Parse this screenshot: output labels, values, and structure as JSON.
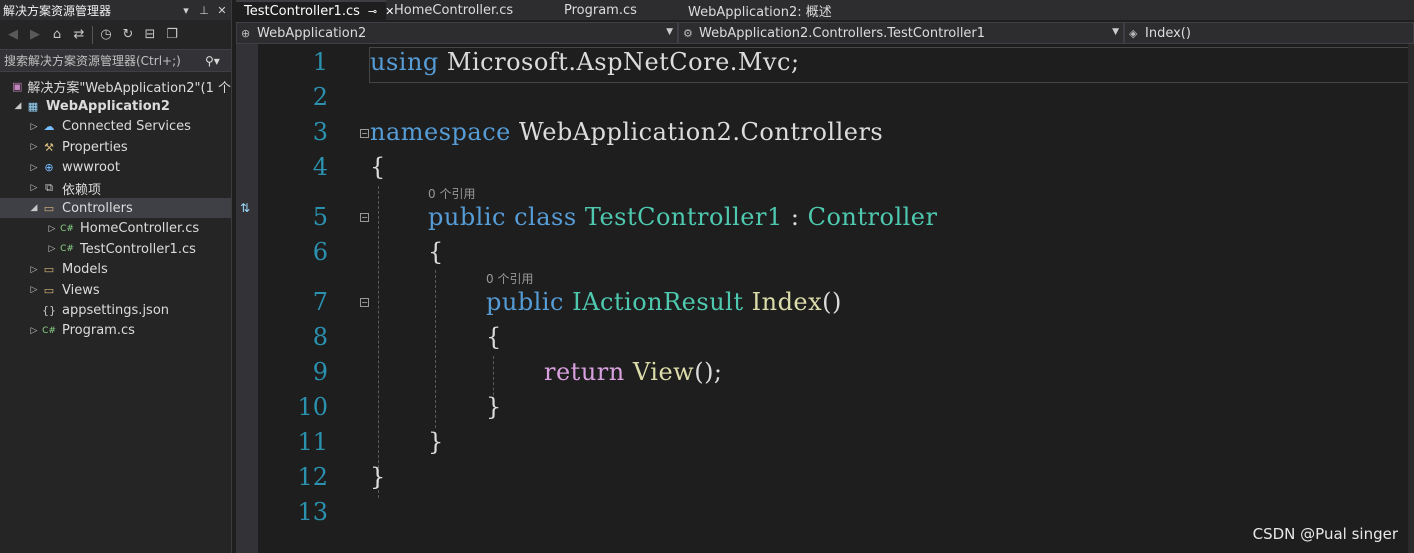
{
  "solution_explorer": {
    "title": "解决方案资源管理器",
    "search_placeholder": "搜索解决方案资源管理器(Ctrl+;)",
    "items": [
      {
        "label": "解决方案\"WebApplication2\"(1 个",
        "name": "tree-item-solution",
        "icon": "solution-icon"
      },
      {
        "label": "WebApplication2",
        "name": "tree-item-project",
        "icon": "project-icon"
      },
      {
        "label": "Connected Services",
        "name": "tree-item-connected-services",
        "icon": "connected-services-icon"
      },
      {
        "label": "Properties",
        "name": "tree-item-properties",
        "icon": "wrench-icon"
      },
      {
        "label": "wwwroot",
        "name": "tree-item-wwwroot",
        "icon": "globe-icon"
      },
      {
        "label": "依赖项",
        "name": "tree-item-dependencies",
        "icon": "dependencies-icon"
      },
      {
        "label": "Controllers",
        "name": "tree-item-controllers",
        "icon": "folder-open-icon"
      },
      {
        "label": "HomeController.cs",
        "name": "tree-item-homecontroller",
        "icon": "csharp-file-icon"
      },
      {
        "label": "TestController1.cs",
        "name": "tree-item-testcontroller1",
        "icon": "csharp-file-icon"
      },
      {
        "label": "Models",
        "name": "tree-item-models",
        "icon": "folder-icon"
      },
      {
        "label": "Views",
        "name": "tree-item-views",
        "icon": "folder-icon"
      },
      {
        "label": "appsettings.json",
        "name": "tree-item-appsettings",
        "icon": "json-file-icon"
      },
      {
        "label": "Program.cs",
        "name": "tree-item-program",
        "icon": "csharp-file-icon"
      }
    ]
  },
  "tabs": [
    {
      "label": "TestController1.cs",
      "active": true
    },
    {
      "label": "HomeController.cs"
    },
    {
      "label": "Program.cs"
    },
    {
      "label": "WebApplication2: 概述"
    }
  ],
  "navbar": {
    "project": "WebApplication2",
    "type": "WebApplication2.Controllers.TestController1",
    "member": "Index()"
  },
  "editor": {
    "line_numbers": [
      "1",
      "2",
      "3",
      "4",
      "5",
      "6",
      "7",
      "8",
      "9",
      "10",
      "11",
      "12",
      "13"
    ],
    "lens_class": "0 个引用",
    "lens_method": "0 个引用",
    "tokens": {
      "l1_kw": "using",
      "l1_rest": " Microsoft.AspNetCore.Mvc;",
      "l3_kw": "namespace",
      "l3_rest": " WebApplication2.Controllers",
      "l4": "{",
      "l5_kw": "public class",
      "l5_type": "TestController1",
      "l5_colon": " : ",
      "l5_base": "Controller",
      "l6": "{",
      "l7_kw": "public",
      "l7_type": "IActionResult",
      "l7_fn": "Index",
      "l7_paren": "()",
      "l8": "{",
      "l9_kw": "return",
      "l9_fn": "View",
      "l9_rest": "();",
      "l10": "}",
      "l11": "}",
      "l12": "}"
    }
  },
  "watermark": "CSDN @Pual singer",
  "colors": {
    "keyword": "#569cd6",
    "type": "#4ec9b0",
    "control": "#d8a0df",
    "method": "#dcdcaa",
    "line_number": "#2b91af"
  }
}
